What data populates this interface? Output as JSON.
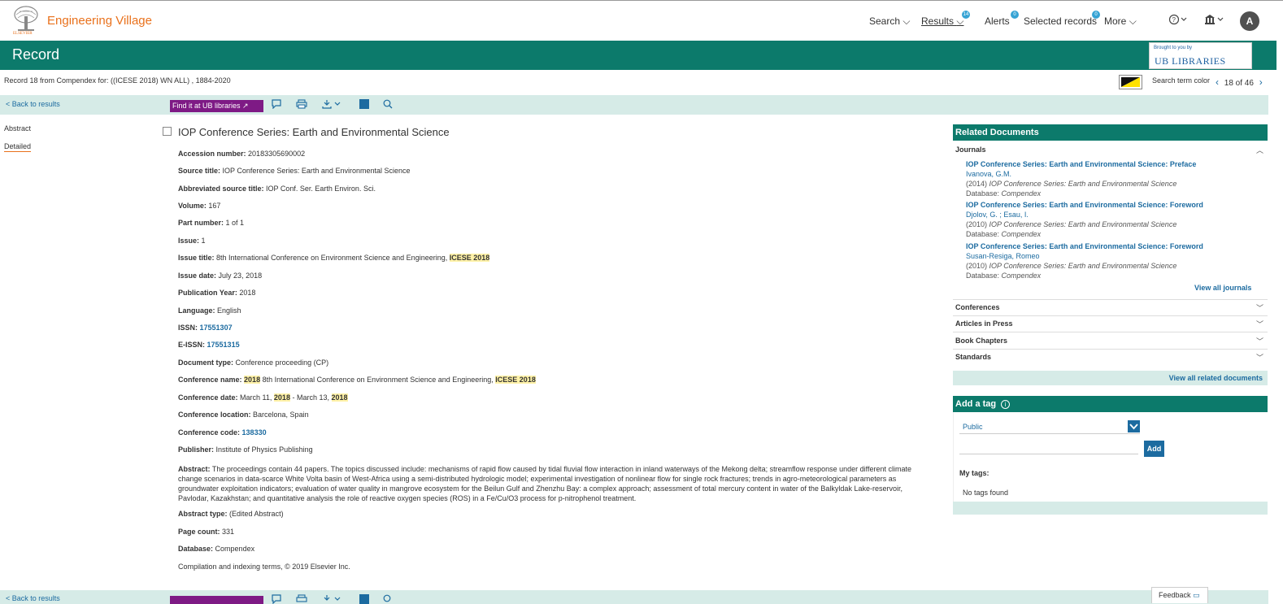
{
  "brand": {
    "name": "Engineering Village",
    "publisher": "ELSEVIER"
  },
  "nav": {
    "search": "Search",
    "results": "Results",
    "results_badge": "14",
    "alerts": "Alerts",
    "alerts_badge": "0",
    "selected": "Selected records",
    "selected_badge": "0",
    "more": "More",
    "avatar": "A"
  },
  "record": {
    "title": "Record",
    "brought_by": "Brought to you by",
    "library": "UB LIBRARIES",
    "info": "Record 18 from Compendex for: ((ICESE 2018) WN ALL) , 1884-2020",
    "search_term_color": "Search term color",
    "pager": "18 of 46"
  },
  "toolbar": {
    "back": "< Back to results",
    "findit": "Find it at UB libraries"
  },
  "leftnav": {
    "abstract": "Abstract",
    "detailed": "Detailed"
  },
  "main": {
    "title": "IOP Conference Series: Earth and Environmental Science",
    "accession_label": "Accession number:",
    "accession": "20183305690002",
    "source_label": "Source title:",
    "source": "IOP Conference Series: Earth and Environmental Science",
    "abbr_label": "Abbreviated source title:",
    "abbr": "IOP Conf. Ser. Earth Environ. Sci.",
    "volume_label": "Volume:",
    "volume": "167",
    "part_label": "Part number:",
    "part": "1 of 1",
    "issue_label": "Issue:",
    "issue": "1",
    "issue_title_label": "Issue title:",
    "issue_title": "8th International Conference on Environment Science and Engineering,",
    "issue_title_hl": "ICESE 2018",
    "issue_date_label": "Issue date:",
    "issue_date": "July 23, 2018",
    "pub_year_label": "Publication Year:",
    "pub_year": "2018",
    "language_label": "Language:",
    "language": "English",
    "issn_label": "ISSN:",
    "issn": "17551307",
    "eissn_label": "E-ISSN:",
    "eissn": "17551315",
    "doctype_label": "Document type:",
    "doctype": "Conference proceeding (CP)",
    "conf_name_label": "Conference name:",
    "conf_name_hl1": "2018",
    "conf_name": "8th International Conference on Environment Science and Engineering,",
    "conf_name_hl2": "ICESE 2018",
    "conf_date_label": "Conference date:",
    "conf_date_a": "March 11,",
    "conf_date_hl1": "2018",
    "conf_date_b": "- March 13,",
    "conf_date_hl2": "2018",
    "conf_loc_label": "Conference location:",
    "conf_loc": "Barcelona, Spain",
    "conf_code_label": "Conference code:",
    "conf_code": "138330",
    "publisher_label": "Publisher:",
    "publisher": "Institute of Physics Publishing",
    "abstract_label": "Abstract:",
    "abstract": "The proceedings contain 44 papers. The topics discussed include: mechanisms of rapid flow caused by tidal fluvial flow interaction in inland waterways of the Mekong delta; streamflow response under different climate change scenarios in data-scarce White Volta basin of West-Africa using a semi-distributed hydrologic model; experimental investigation of nonlinear flow for single rock fractures; trends in agro-meteorological parameters as groundwater exploitation indicators; evaluation of water quality in mangrove ecosystem for the Beilun Gulf and Zhenzhu Bay: a complex approach; assessment of total mercury content in water of the Balkyldak Lake-reservoir, Pavlodar, Kazakhstan; and quantitative analysis the role of reactive oxygen species (ROS) in a Fe/Cu/O3 process for p-nitrophenol treatment.",
    "abstract_type_label": "Abstract type:",
    "abstract_type": "(Edited Abstract)",
    "page_count_label": "Page count:",
    "page_count": "331",
    "database_label": "Database:",
    "database": "Compendex",
    "copyright": "Compilation and indexing terms, © 2019 Elsevier Inc."
  },
  "related": {
    "heading": "Related Documents",
    "journals": "Journals",
    "items": [
      {
        "title": "IOP Conference Series: Earth and Environmental Science: Preface",
        "authors": "Ivanova, G.M.",
        "year": "(2014)",
        "source": "IOP Conference Series: Earth and Environmental Science",
        "db_label": "Database:",
        "db": "Compendex"
      },
      {
        "title": "IOP Conference Series: Earth and Environmental Science: Foreword",
        "authors": "Djolov, G. ; Esau, I.",
        "year": "(2010)",
        "source": "IOP Conference Series: Earth and Environmental Science",
        "db_label": "Database:",
        "db": "Compendex"
      },
      {
        "title": "IOP Conference Series: Earth and Environmental Science: Foreword",
        "authors": "Susan-Resiga, Romeo",
        "year": "(2010)",
        "source": "IOP Conference Series: Earth and Environmental Science",
        "db_label": "Database:",
        "db": "Compendex"
      }
    ],
    "view_all_journals": "View all journals",
    "conferences": "Conferences",
    "articles_in_press": "Articles in Press",
    "book_chapters": "Book Chapters",
    "standards": "Standards",
    "view_all_related": "View all related documents"
  },
  "tags": {
    "heading": "Add a tag",
    "visibility": "Public",
    "add": "Add",
    "my_tags": "My tags:",
    "none": "No tags found"
  },
  "feedback": "Feedback",
  "colors": {
    "teal": "#0c7a6b",
    "orange": "#e9711c",
    "purple": "#7e1a85",
    "link": "#1c6ba0",
    "highlight": "#fff2a8"
  }
}
